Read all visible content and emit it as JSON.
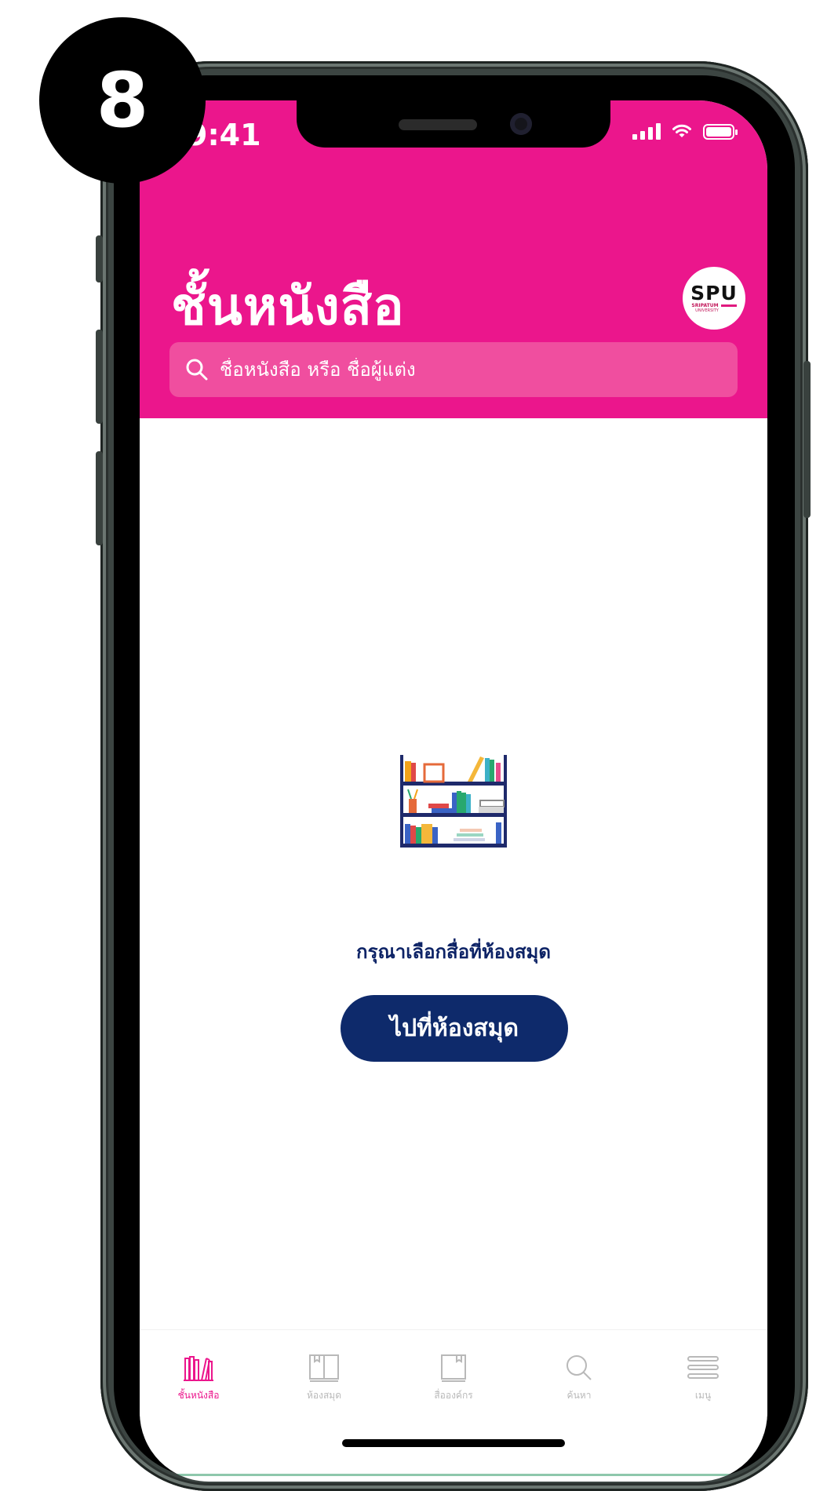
{
  "step_badge": "8",
  "status_bar": {
    "time": "9:41"
  },
  "header": {
    "title": "ชั้นหนังสือ",
    "logo": {
      "text": "SPU",
      "subtext": "SRIPATUM",
      "subtext2": "UNIVERSITY"
    },
    "search": {
      "placeholder": "ชื่อหนังสือ หรือ ชื่อผู้แต่ง",
      "value": ""
    }
  },
  "empty_state": {
    "message": "กรุณาเลือกสื่อที่ห้องสมุด",
    "button_label": "ไปที่ห้องสมุด",
    "illustration": "bookshelf-illustration"
  },
  "tab_bar": {
    "items": [
      {
        "label": "ชั้นหนังสือ",
        "icon": "bookshelf-icon",
        "active": true
      },
      {
        "label": "ห้องสมุด",
        "icon": "open-book-icon",
        "active": false
      },
      {
        "label": "สื่อองค์กร",
        "icon": "book-icon",
        "active": false
      },
      {
        "label": "ค้นหา",
        "icon": "search-icon",
        "active": false
      },
      {
        "label": "เมนู",
        "icon": "menu-icon",
        "active": false
      }
    ]
  },
  "colors": {
    "brand_pink": "#eb168c",
    "search_bg": "#f04e9f",
    "navy": "#0e2a6b",
    "inactive": "#b9b9b9"
  }
}
